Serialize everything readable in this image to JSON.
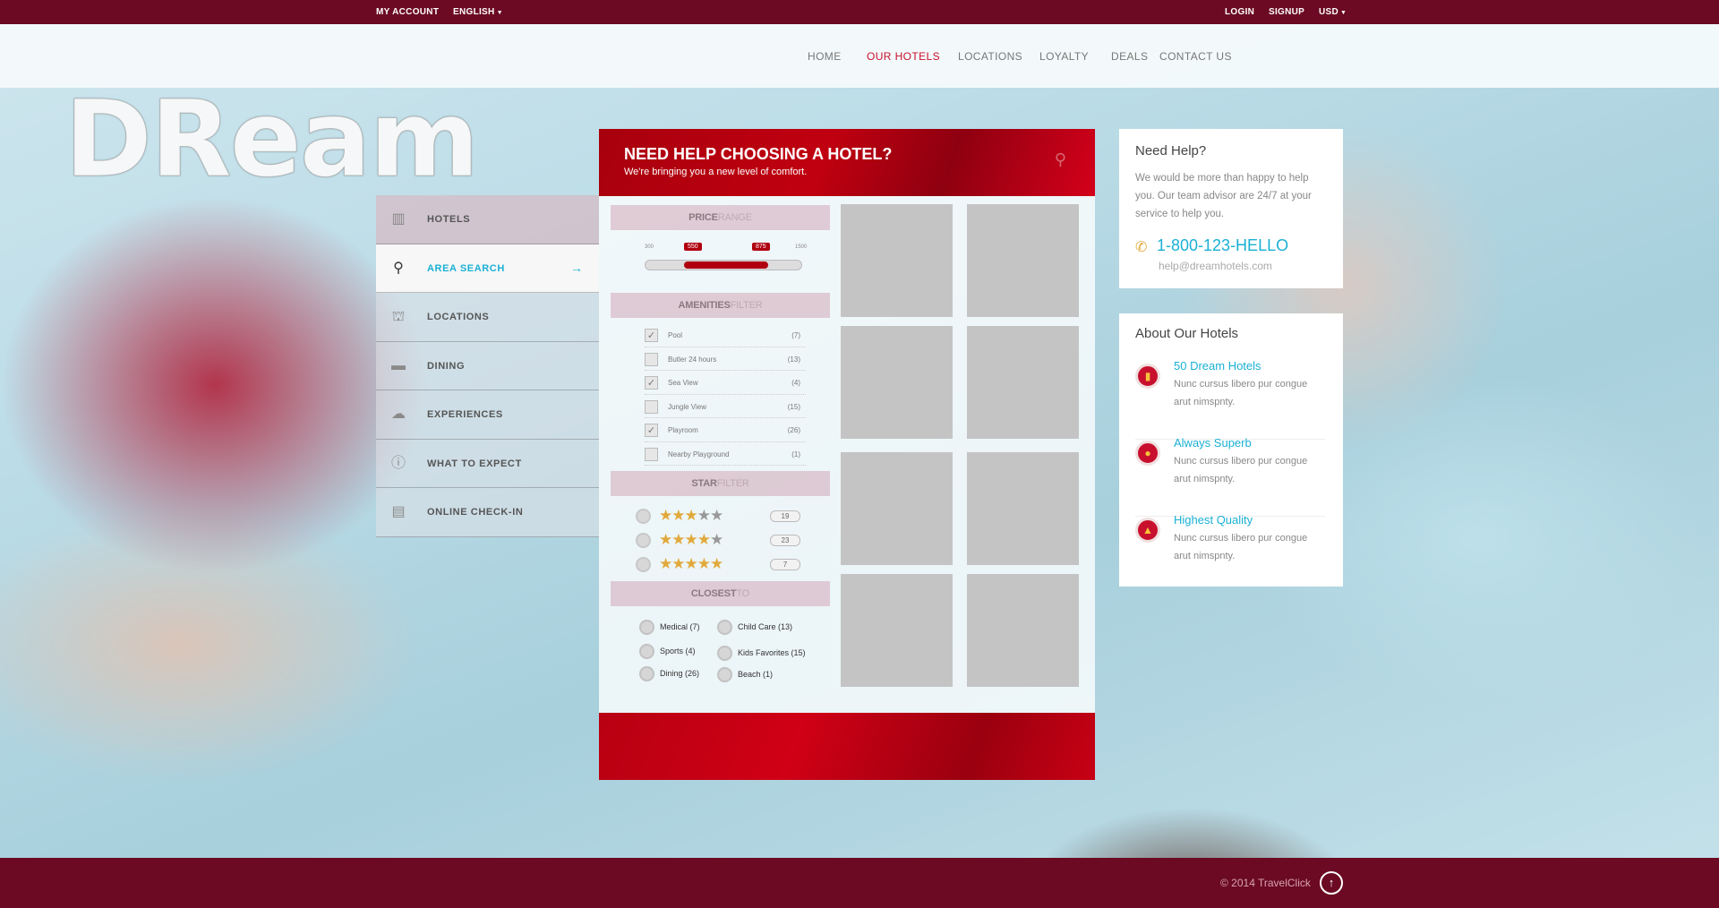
{
  "topbar": {
    "my_account": "MY ACCOUNT",
    "language": "ENGLISH",
    "login": "LOGIN",
    "signup": "SIGNUP",
    "currency": "USD"
  },
  "nav": {
    "items": [
      "HOME",
      "OUR HOTELS",
      "LOCATIONS",
      "LOYALTY",
      "DEALS",
      "CONTACT US"
    ],
    "active": "OUR HOTELS"
  },
  "logo": {
    "text": "DReam"
  },
  "sidebar": {
    "items": [
      {
        "label": "HOTELS",
        "icon": "hotel-icon"
      },
      {
        "label": "AREA SEARCH",
        "icon": "search-icon",
        "active": true
      },
      {
        "label": "LOCATIONS",
        "icon": "locations-icon"
      },
      {
        "label": "DINING",
        "icon": "dining-icon"
      },
      {
        "label": "EXPERIENCES",
        "icon": "experiences-icon"
      },
      {
        "label": "WHAT TO EXPECT",
        "icon": "info-icon"
      },
      {
        "label": "ONLINE CHECK-IN",
        "icon": "document-icon"
      }
    ]
  },
  "search_panel": {
    "title": "NEED HELP CHOOSING A HOTEL?",
    "subtitle": "We're bringing you a new level of comfort.",
    "price": {
      "head_bold": "PRICE",
      "head_light": "RANGE",
      "min": "300",
      "max": "1500",
      "low": "550",
      "high": "875"
    },
    "amenities": {
      "head_bold": "AMENITIES",
      "head_light": "FILTER",
      "items": [
        {
          "name": "Pool",
          "count": "(7)",
          "checked": true
        },
        {
          "name": "Butler 24 hours",
          "count": "(13)",
          "checked": false
        },
        {
          "name": "Sea View",
          "count": "(4)",
          "checked": true
        },
        {
          "name": "Jungle View",
          "count": "(15)",
          "checked": false
        },
        {
          "name": "Playroom",
          "count": "(26)",
          "checked": true
        },
        {
          "name": "Nearby Playground",
          "count": "(1)",
          "checked": false
        }
      ]
    },
    "stars": {
      "head_bold": "STAR",
      "head_light": "FILTER",
      "items": [
        {
          "rating": 3,
          "count": "19"
        },
        {
          "rating": 4,
          "count": "23"
        },
        {
          "rating": 5,
          "count": "7"
        }
      ]
    },
    "closest": {
      "head_bold": "CLOSEST",
      "head_light": "TO",
      "items": [
        "Medical (7)",
        "Child Care (13)",
        "Sports (4)",
        "Kids Favorites (15)",
        "Dining (26)",
        "Beach (1)"
      ]
    }
  },
  "help": {
    "title": "Need Help?",
    "text": "We would be more than happy to help you. Our team advisor are 24/7 at your service to help you.",
    "phone": "1-800-123-HELLO",
    "email": "help@dreamhotels.com"
  },
  "about": {
    "title": "About Our Hotels",
    "features": [
      {
        "title": "50 Dream Hotels",
        "text": "Nunc cursus libero pur congue arut nimspnty."
      },
      {
        "title": "Always Superb",
        "text": "Nunc cursus libero pur congue arut nimspnty."
      },
      {
        "title": "Highest Quality",
        "text": "Nunc cursus libero pur congue arut nimspnty."
      }
    ]
  },
  "footer": {
    "copyright": "© 2014 TravelClick"
  },
  "colors": {
    "brand": "#6b0a22",
    "accent": "#1ab0d4",
    "red": "#c8102e"
  }
}
